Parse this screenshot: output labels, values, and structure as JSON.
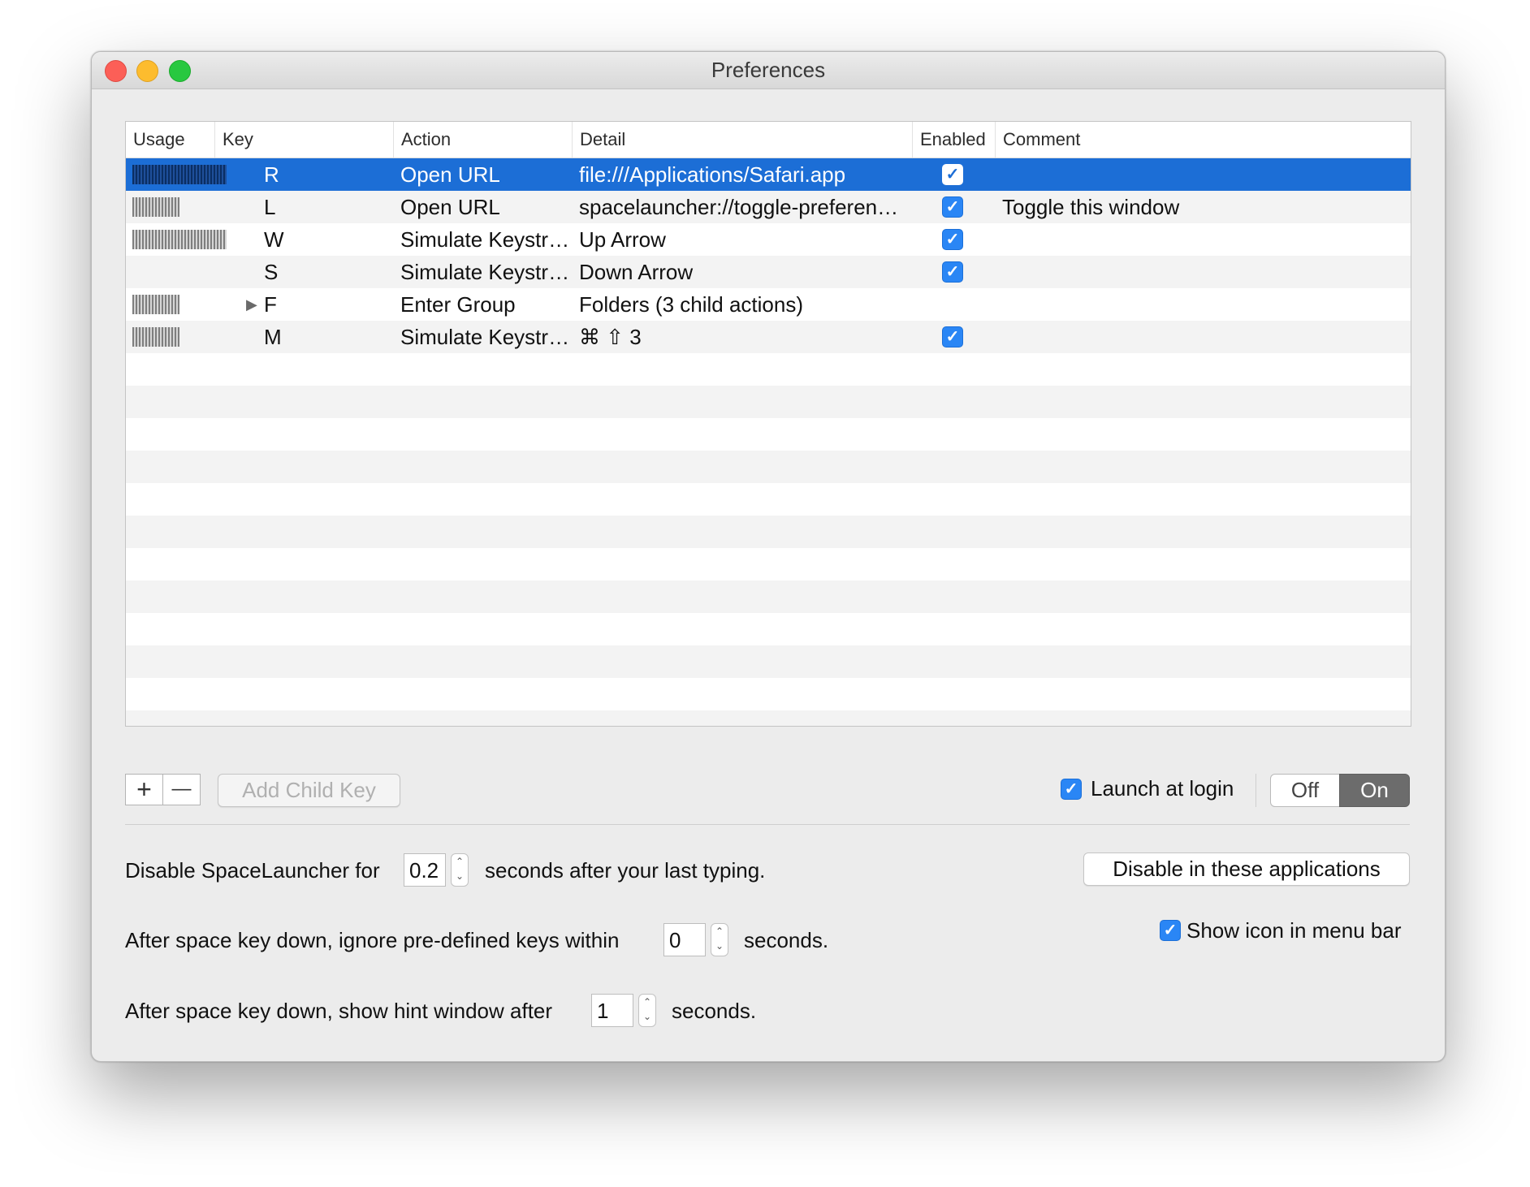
{
  "window": {
    "title": "Preferences"
  },
  "table": {
    "columns": [
      "Usage",
      "Key",
      "Action",
      "Detail",
      "Enabled",
      "Comment"
    ],
    "rows": [
      {
        "usage": 1.0,
        "key": "R",
        "action": "Open URL",
        "detail": "file:///Applications/Safari.app",
        "enabled": true,
        "comment": "",
        "selected": true,
        "group": false
      },
      {
        "usage": 0.5,
        "key": "L",
        "action": "Open URL",
        "detail": "spacelauncher://toggle-preferences-w...",
        "enabled": true,
        "comment": "Toggle this window",
        "selected": false,
        "group": false
      },
      {
        "usage": 1.0,
        "key": "W",
        "action": "Simulate Keystroke",
        "detail": "Up Arrow",
        "enabled": true,
        "comment": "",
        "selected": false,
        "group": false
      },
      {
        "usage": 0.0,
        "key": "S",
        "action": "Simulate Keystroke",
        "detail": "Down Arrow",
        "enabled": true,
        "comment": "",
        "selected": false,
        "group": false
      },
      {
        "usage": 0.5,
        "key": "F",
        "action": "Enter Group",
        "detail": "Folders (3 child actions)",
        "enabled": false,
        "comment": "",
        "selected": false,
        "group": true
      },
      {
        "usage": 0.5,
        "key": "M",
        "action": "Simulate Keystroke",
        "detail": "⌘ ⇧ 3",
        "enabled": true,
        "comment": "",
        "selected": false,
        "group": false
      }
    ]
  },
  "toolbar": {
    "add_label": "+",
    "remove_label": "—",
    "add_child_label": "Add Child Key",
    "launch_at_login_label": "Launch at login",
    "launch_at_login_checked": true,
    "toggle_off_label": "Off",
    "toggle_on_label": "On",
    "toggle_selected": "On"
  },
  "settings": {
    "disable_for": {
      "prefix": "Disable SpaceLauncher for",
      "value": "0.2",
      "suffix": "seconds after your last typing."
    },
    "ignore_keys": {
      "prefix": "After space key down, ignore pre-defined keys within",
      "value": "0",
      "suffix": "seconds."
    },
    "hint_window": {
      "prefix": "After space key down, show hint window after",
      "value": "1",
      "suffix": "seconds."
    },
    "disable_apps_label": "Disable in these applications",
    "show_icon_label": "Show icon in menu bar",
    "show_icon_checked": true
  },
  "icons": {
    "close": "close-icon",
    "minimize": "minimize-icon",
    "zoom": "zoom-icon",
    "check": "checkmark-icon",
    "disclosure": "disclosure-triangle-icon",
    "stepper": "stepper-arrows-icon"
  },
  "colors": {
    "selection": "#1c6ed6",
    "checkbox": "#2a86f5",
    "toggle_on": "#6c6c6c"
  }
}
